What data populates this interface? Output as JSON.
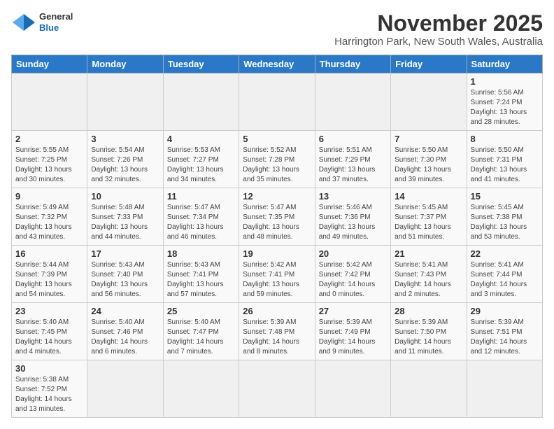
{
  "header": {
    "logo_line1": "General",
    "logo_line2": "Blue",
    "title": "November 2025",
    "subtitle": "Harrington Park, New South Wales, Australia"
  },
  "days_of_week": [
    "Sunday",
    "Monday",
    "Tuesday",
    "Wednesday",
    "Thursday",
    "Friday",
    "Saturday"
  ],
  "weeks": [
    [
      {
        "day": "",
        "info": ""
      },
      {
        "day": "",
        "info": ""
      },
      {
        "day": "",
        "info": ""
      },
      {
        "day": "",
        "info": ""
      },
      {
        "day": "",
        "info": ""
      },
      {
        "day": "",
        "info": ""
      },
      {
        "day": "1",
        "info": "Sunrise: 5:56 AM\nSunset: 7:24 PM\nDaylight: 13 hours\nand 28 minutes."
      }
    ],
    [
      {
        "day": "2",
        "info": "Sunrise: 5:55 AM\nSunset: 7:25 PM\nDaylight: 13 hours\nand 30 minutes."
      },
      {
        "day": "3",
        "info": "Sunrise: 5:54 AM\nSunset: 7:26 PM\nDaylight: 13 hours\nand 32 minutes."
      },
      {
        "day": "4",
        "info": "Sunrise: 5:53 AM\nSunset: 7:27 PM\nDaylight: 13 hours\nand 34 minutes."
      },
      {
        "day": "5",
        "info": "Sunrise: 5:52 AM\nSunset: 7:28 PM\nDaylight: 13 hours\nand 35 minutes."
      },
      {
        "day": "6",
        "info": "Sunrise: 5:51 AM\nSunset: 7:29 PM\nDaylight: 13 hours\nand 37 minutes."
      },
      {
        "day": "7",
        "info": "Sunrise: 5:50 AM\nSunset: 7:30 PM\nDaylight: 13 hours\nand 39 minutes."
      },
      {
        "day": "8",
        "info": "Sunrise: 5:50 AM\nSunset: 7:31 PM\nDaylight: 13 hours\nand 41 minutes."
      }
    ],
    [
      {
        "day": "9",
        "info": "Sunrise: 5:49 AM\nSunset: 7:32 PM\nDaylight: 13 hours\nand 43 minutes."
      },
      {
        "day": "10",
        "info": "Sunrise: 5:48 AM\nSunset: 7:33 PM\nDaylight: 13 hours\nand 44 minutes."
      },
      {
        "day": "11",
        "info": "Sunrise: 5:47 AM\nSunset: 7:34 PM\nDaylight: 13 hours\nand 46 minutes."
      },
      {
        "day": "12",
        "info": "Sunrise: 5:47 AM\nSunset: 7:35 PM\nDaylight: 13 hours\nand 48 minutes."
      },
      {
        "day": "13",
        "info": "Sunrise: 5:46 AM\nSunset: 7:36 PM\nDaylight: 13 hours\nand 49 minutes."
      },
      {
        "day": "14",
        "info": "Sunrise: 5:45 AM\nSunset: 7:37 PM\nDaylight: 13 hours\nand 51 minutes."
      },
      {
        "day": "15",
        "info": "Sunrise: 5:45 AM\nSunset: 7:38 PM\nDaylight: 13 hours\nand 53 minutes."
      }
    ],
    [
      {
        "day": "16",
        "info": "Sunrise: 5:44 AM\nSunset: 7:39 PM\nDaylight: 13 hours\nand 54 minutes."
      },
      {
        "day": "17",
        "info": "Sunrise: 5:43 AM\nSunset: 7:40 PM\nDaylight: 13 hours\nand 56 minutes."
      },
      {
        "day": "18",
        "info": "Sunrise: 5:43 AM\nSunset: 7:41 PM\nDaylight: 13 hours\nand 57 minutes."
      },
      {
        "day": "19",
        "info": "Sunrise: 5:42 AM\nSunset: 7:41 PM\nDaylight: 13 hours\nand 59 minutes."
      },
      {
        "day": "20",
        "info": "Sunrise: 5:42 AM\nSunset: 7:42 PM\nDaylight: 14 hours\nand 0 minutes."
      },
      {
        "day": "21",
        "info": "Sunrise: 5:41 AM\nSunset: 7:43 PM\nDaylight: 14 hours\nand 2 minutes."
      },
      {
        "day": "22",
        "info": "Sunrise: 5:41 AM\nSunset: 7:44 PM\nDaylight: 14 hours\nand 3 minutes."
      }
    ],
    [
      {
        "day": "23",
        "info": "Sunrise: 5:40 AM\nSunset: 7:45 PM\nDaylight: 14 hours\nand 4 minutes."
      },
      {
        "day": "24",
        "info": "Sunrise: 5:40 AM\nSunset: 7:46 PM\nDaylight: 14 hours\nand 6 minutes."
      },
      {
        "day": "25",
        "info": "Sunrise: 5:40 AM\nSunset: 7:47 PM\nDaylight: 14 hours\nand 7 minutes."
      },
      {
        "day": "26",
        "info": "Sunrise: 5:39 AM\nSunset: 7:48 PM\nDaylight: 14 hours\nand 8 minutes."
      },
      {
        "day": "27",
        "info": "Sunrise: 5:39 AM\nSunset: 7:49 PM\nDaylight: 14 hours\nand 9 minutes."
      },
      {
        "day": "28",
        "info": "Sunrise: 5:39 AM\nSunset: 7:50 PM\nDaylight: 14 hours\nand 11 minutes."
      },
      {
        "day": "29",
        "info": "Sunrise: 5:39 AM\nSunset: 7:51 PM\nDaylight: 14 hours\nand 12 minutes."
      }
    ],
    [
      {
        "day": "30",
        "info": "Sunrise: 5:38 AM\nSunset: 7:52 PM\nDaylight: 14 hours\nand 13 minutes."
      },
      {
        "day": "",
        "info": ""
      },
      {
        "day": "",
        "info": ""
      },
      {
        "day": "",
        "info": ""
      },
      {
        "day": "",
        "info": ""
      },
      {
        "day": "",
        "info": ""
      },
      {
        "day": "",
        "info": ""
      }
    ]
  ]
}
